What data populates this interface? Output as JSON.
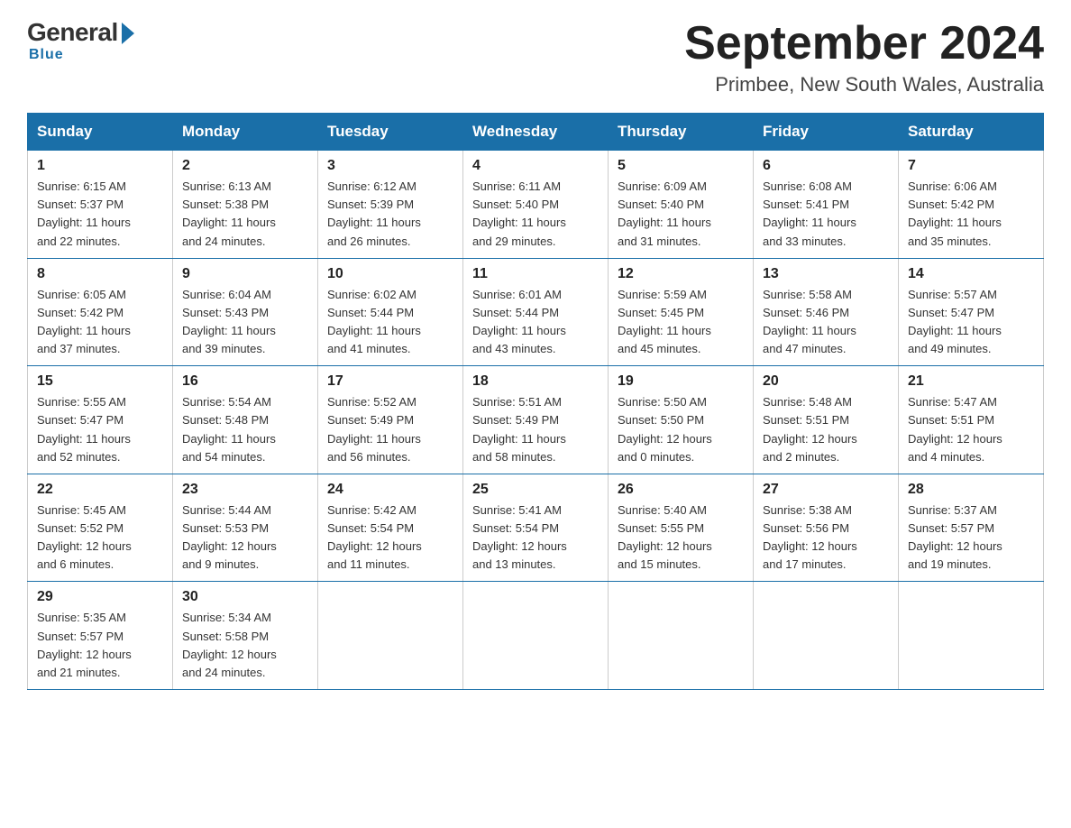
{
  "logo": {
    "general": "General",
    "blue": "Blue",
    "tagline": "Blue"
  },
  "header": {
    "month": "September 2024",
    "location": "Primbee, New South Wales, Australia"
  },
  "days_of_week": [
    "Sunday",
    "Monday",
    "Tuesday",
    "Wednesday",
    "Thursday",
    "Friday",
    "Saturday"
  ],
  "weeks": [
    [
      {
        "day": "1",
        "sunrise": "6:15 AM",
        "sunset": "5:37 PM",
        "daylight": "11 hours and 22 minutes."
      },
      {
        "day": "2",
        "sunrise": "6:13 AM",
        "sunset": "5:38 PM",
        "daylight": "11 hours and 24 minutes."
      },
      {
        "day": "3",
        "sunrise": "6:12 AM",
        "sunset": "5:39 PM",
        "daylight": "11 hours and 26 minutes."
      },
      {
        "day": "4",
        "sunrise": "6:11 AM",
        "sunset": "5:40 PM",
        "daylight": "11 hours and 29 minutes."
      },
      {
        "day": "5",
        "sunrise": "6:09 AM",
        "sunset": "5:40 PM",
        "daylight": "11 hours and 31 minutes."
      },
      {
        "day": "6",
        "sunrise": "6:08 AM",
        "sunset": "5:41 PM",
        "daylight": "11 hours and 33 minutes."
      },
      {
        "day": "7",
        "sunrise": "6:06 AM",
        "sunset": "5:42 PM",
        "daylight": "11 hours and 35 minutes."
      }
    ],
    [
      {
        "day": "8",
        "sunrise": "6:05 AM",
        "sunset": "5:42 PM",
        "daylight": "11 hours and 37 minutes."
      },
      {
        "day": "9",
        "sunrise": "6:04 AM",
        "sunset": "5:43 PM",
        "daylight": "11 hours and 39 minutes."
      },
      {
        "day": "10",
        "sunrise": "6:02 AM",
        "sunset": "5:44 PM",
        "daylight": "11 hours and 41 minutes."
      },
      {
        "day": "11",
        "sunrise": "6:01 AM",
        "sunset": "5:44 PM",
        "daylight": "11 hours and 43 minutes."
      },
      {
        "day": "12",
        "sunrise": "5:59 AM",
        "sunset": "5:45 PM",
        "daylight": "11 hours and 45 minutes."
      },
      {
        "day": "13",
        "sunrise": "5:58 AM",
        "sunset": "5:46 PM",
        "daylight": "11 hours and 47 minutes."
      },
      {
        "day": "14",
        "sunrise": "5:57 AM",
        "sunset": "5:47 PM",
        "daylight": "11 hours and 49 minutes."
      }
    ],
    [
      {
        "day": "15",
        "sunrise": "5:55 AM",
        "sunset": "5:47 PM",
        "daylight": "11 hours and 52 minutes."
      },
      {
        "day": "16",
        "sunrise": "5:54 AM",
        "sunset": "5:48 PM",
        "daylight": "11 hours and 54 minutes."
      },
      {
        "day": "17",
        "sunrise": "5:52 AM",
        "sunset": "5:49 PM",
        "daylight": "11 hours and 56 minutes."
      },
      {
        "day": "18",
        "sunrise": "5:51 AM",
        "sunset": "5:49 PM",
        "daylight": "11 hours and 58 minutes."
      },
      {
        "day": "19",
        "sunrise": "5:50 AM",
        "sunset": "5:50 PM",
        "daylight": "12 hours and 0 minutes."
      },
      {
        "day": "20",
        "sunrise": "5:48 AM",
        "sunset": "5:51 PM",
        "daylight": "12 hours and 2 minutes."
      },
      {
        "day": "21",
        "sunrise": "5:47 AM",
        "sunset": "5:51 PM",
        "daylight": "12 hours and 4 minutes."
      }
    ],
    [
      {
        "day": "22",
        "sunrise": "5:45 AM",
        "sunset": "5:52 PM",
        "daylight": "12 hours and 6 minutes."
      },
      {
        "day": "23",
        "sunrise": "5:44 AM",
        "sunset": "5:53 PM",
        "daylight": "12 hours and 9 minutes."
      },
      {
        "day": "24",
        "sunrise": "5:42 AM",
        "sunset": "5:54 PM",
        "daylight": "12 hours and 11 minutes."
      },
      {
        "day": "25",
        "sunrise": "5:41 AM",
        "sunset": "5:54 PM",
        "daylight": "12 hours and 13 minutes."
      },
      {
        "day": "26",
        "sunrise": "5:40 AM",
        "sunset": "5:55 PM",
        "daylight": "12 hours and 15 minutes."
      },
      {
        "day": "27",
        "sunrise": "5:38 AM",
        "sunset": "5:56 PM",
        "daylight": "12 hours and 17 minutes."
      },
      {
        "day": "28",
        "sunrise": "5:37 AM",
        "sunset": "5:57 PM",
        "daylight": "12 hours and 19 minutes."
      }
    ],
    [
      {
        "day": "29",
        "sunrise": "5:35 AM",
        "sunset": "5:57 PM",
        "daylight": "12 hours and 21 minutes."
      },
      {
        "day": "30",
        "sunrise": "5:34 AM",
        "sunset": "5:58 PM",
        "daylight": "12 hours and 24 minutes."
      },
      null,
      null,
      null,
      null,
      null
    ]
  ],
  "labels": {
    "sunrise": "Sunrise:",
    "sunset": "Sunset:",
    "daylight": "Daylight:"
  }
}
